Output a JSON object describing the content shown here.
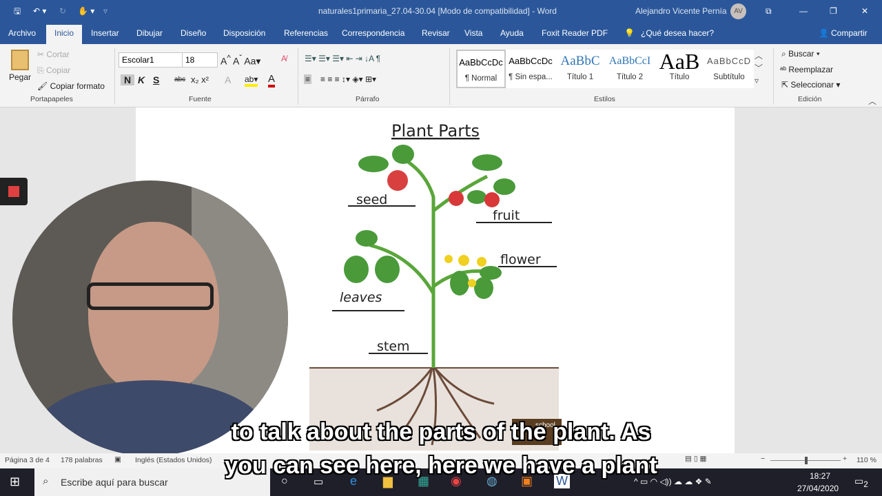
{
  "titlebar": {
    "title": "naturales1primaria_27.04-30.04 [Modo de compatibilidad]  -  Word",
    "user": "Alejandro Vicente Pernía",
    "avatar": "AV"
  },
  "tabs": [
    {
      "label": "Archivo"
    },
    {
      "label": "Inicio"
    },
    {
      "label": "Insertar"
    },
    {
      "label": "Dibujar"
    },
    {
      "label": "Diseño"
    },
    {
      "label": "Disposición"
    },
    {
      "label": "Referencias"
    },
    {
      "label": "Correspondencia"
    },
    {
      "label": "Revisar"
    },
    {
      "label": "Vista"
    },
    {
      "label": "Ayuda"
    },
    {
      "label": "Foxit Reader PDF"
    }
  ],
  "tellme": "¿Qué desea hacer?",
  "share": "Compartir",
  "clipboard": {
    "paste": "Pegar",
    "cut": "Cortar",
    "copy": "Copiar",
    "format": "Copiar formato",
    "group": "Portapapeles"
  },
  "font": {
    "name": "Escolar1",
    "size": "18",
    "bold": "N",
    "italic": "K",
    "underline": "S",
    "strike": "abc",
    "group": "Fuente"
  },
  "paragraph": {
    "group": "Párrafo"
  },
  "styles": {
    "items": [
      {
        "preview": "AaBbCcDc",
        "name": "¶ Normal"
      },
      {
        "preview": "AaBbCcDc",
        "name": "¶ Sin espa..."
      },
      {
        "preview": "AaBbC",
        "name": "Título 1"
      },
      {
        "preview": "AaBbCcI",
        "name": "Título 2"
      },
      {
        "preview": "AaB",
        "name": "Título"
      },
      {
        "preview": "AaBbCcD",
        "name": "Subtítulo"
      }
    ],
    "group": "Estilos"
  },
  "editing": {
    "find": "Buscar",
    "replace": "Reemplazar",
    "select": "Seleccionar",
    "group": "Edición"
  },
  "document": {
    "title": "Plant Parts",
    "labels": {
      "seed": "seed",
      "fruit": "fruit",
      "flower": "flower",
      "leaves": "leaves",
      "stem": "stem"
    },
    "logo": "school"
  },
  "subtitles": [
    "to talk about the parts of the plant. As",
    "you can see here, here we have a plant"
  ],
  "status": {
    "page": "Página 3 de 4",
    "words": "178 palabras",
    "language": "Inglés (Estados Unidos)",
    "zoom": "110 %",
    "zoom_level": 110
  },
  "taskbar": {
    "search": "Escribe aquí para buscar",
    "time": "18:27",
    "date": "27/04/2020",
    "notifications": "2"
  }
}
